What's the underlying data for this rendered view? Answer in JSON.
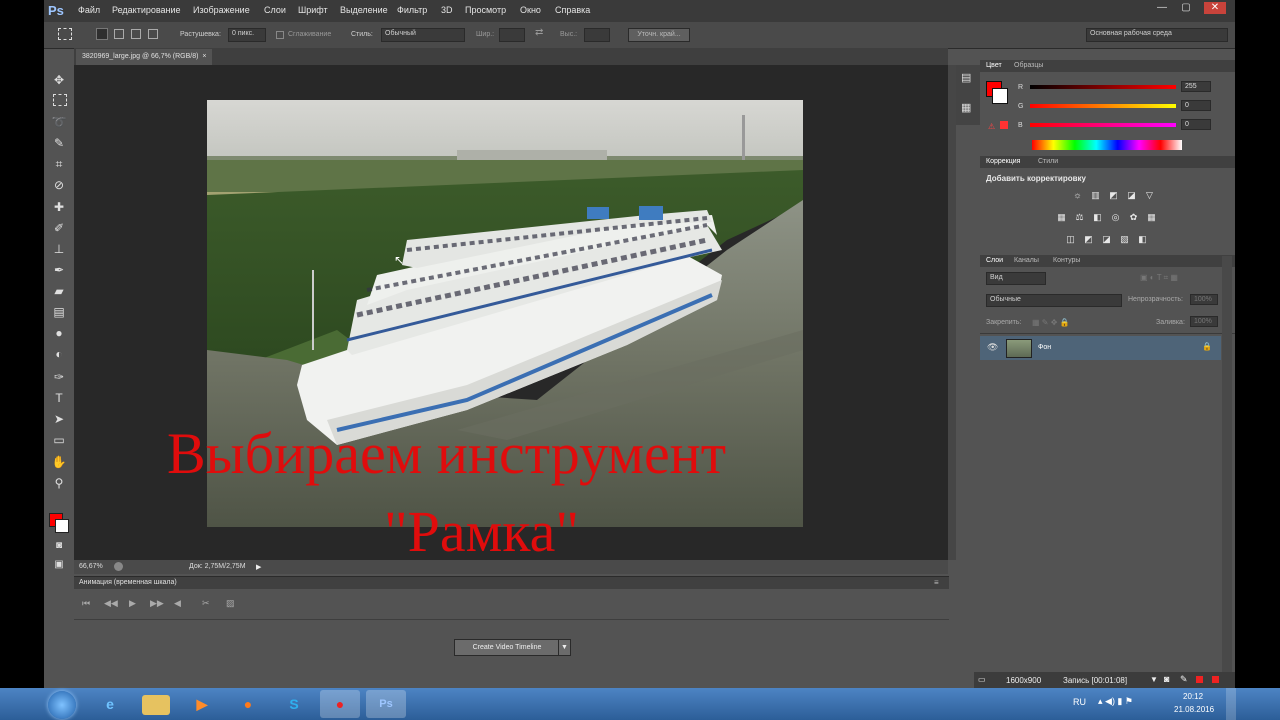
{
  "app": {
    "logo": "Ps",
    "menu": [
      "Файл",
      "Редактирование",
      "Изображение",
      "Слои",
      "Шрифт",
      "Выделение",
      "Фильтр",
      "3D",
      "Просмотр",
      "Окно",
      "Справка"
    ],
    "window_controls": {
      "minimize": "—",
      "restore": "▢",
      "close": "✕"
    }
  },
  "options_bar": {
    "feather_label": "Растушевка:",
    "feather_value": "0 пикс.",
    "antialias_label": "Сглаживание",
    "style_label": "Стиль:",
    "style_value": "Обычный",
    "width_label": "Шир.:",
    "height_label": "Выс.:",
    "refine_button": "Уточн. край...",
    "workspace": "Основная рабочая среда"
  },
  "document": {
    "tab_title": "3820969_large.jpg @ 66,7% (RGB/8)",
    "zoom": "66,67%",
    "doc_size": "Док: 2,75M/2,75M"
  },
  "caption": {
    "line1": "Выбираем инструмент",
    "line2": "\"Рамка\""
  },
  "timeline": {
    "title": "Анимация (временная шкала)",
    "create_button": "Create Video Timeline",
    "controls": [
      "⏮",
      "◀◀",
      "▶",
      "▶▶",
      "◀",
      "✂",
      "▨"
    ]
  },
  "color_panel": {
    "tabs": [
      "Цвет",
      "Образцы"
    ],
    "channels": [
      {
        "label": "R",
        "value": "255"
      },
      {
        "label": "G",
        "value": "0"
      },
      {
        "label": "B",
        "value": "0"
      }
    ],
    "foreground_color": "#ff0000",
    "background_color": "#ffffff"
  },
  "adjustments_panel": {
    "tabs": [
      "Коррекция",
      "Стили"
    ],
    "title": "Добавить корректировку"
  },
  "layers_panel": {
    "tabs": [
      "Слои",
      "Каналы",
      "Контуры"
    ],
    "filter_label": "Вид",
    "blend_mode": "Обычные",
    "opacity_label": "Непрозрачность:",
    "opacity_value": "100%",
    "lock_label": "Закрепить:",
    "fill_label": "Заливка:",
    "fill_value": "100%",
    "layers": [
      {
        "name": "Фон"
      }
    ]
  },
  "recorder": {
    "resolution": "1600x900",
    "record_label": "Запись [00:01:08]"
  },
  "taskbar": {
    "lang": "RU",
    "time": "20:12",
    "date": "21.08.2016",
    "ps_label": "Ps"
  },
  "colors": {
    "accent_red": "#e00c0c",
    "panel_bg": "#535353",
    "canvas_bg": "#282828"
  }
}
